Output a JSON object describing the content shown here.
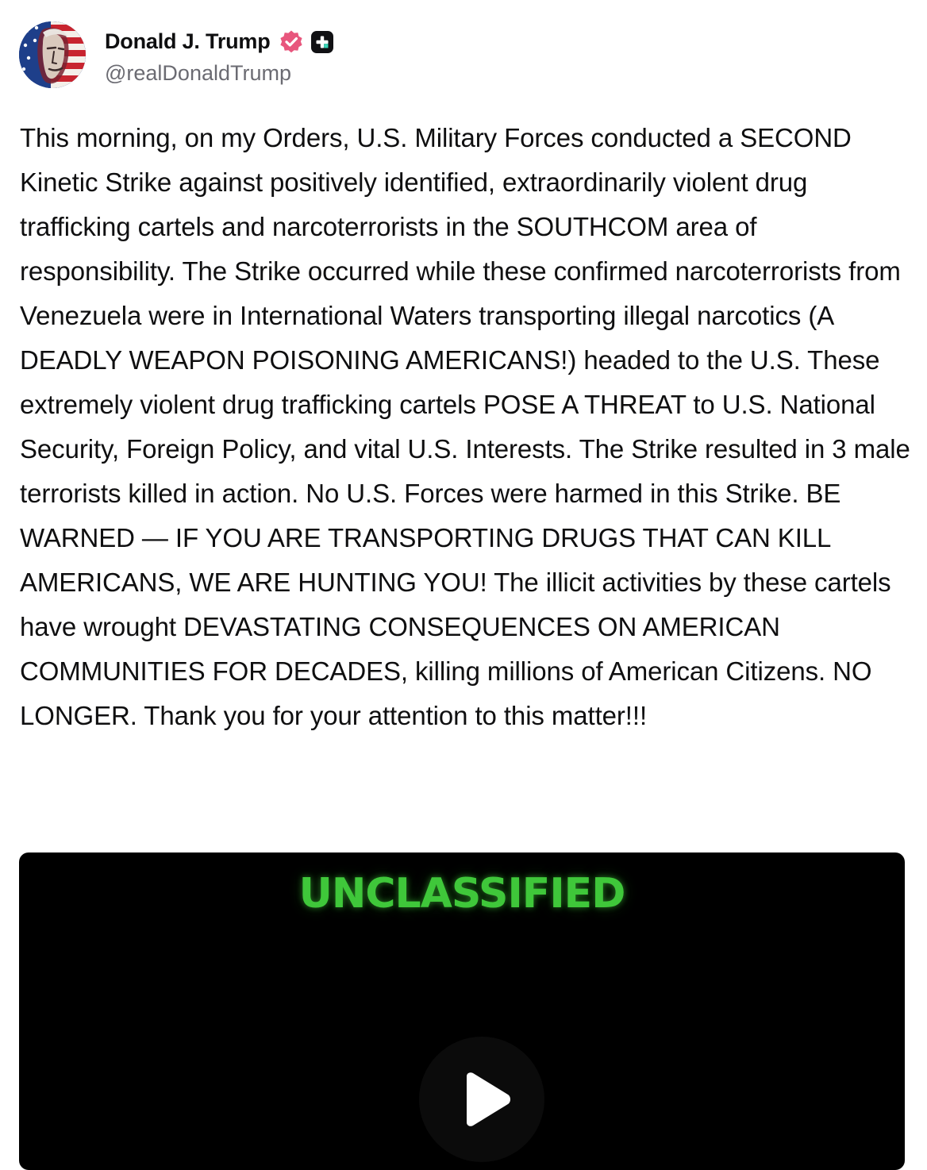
{
  "author": {
    "display_name": "Donald J. Trump",
    "handle": "@realDonaldTrump",
    "avatar_icon": "portrait-flag-avatar",
    "verified_icon": "verified-badge-icon",
    "verified_color": "#e8567d",
    "plus_icon": "plus-badge-icon"
  },
  "post": {
    "text": "This morning, on my Orders, U.S. Military Forces conducted a SECOND Kinetic Strike against positively identified, extraordinarily violent drug trafficking cartels and narcoterrorists in the SOUTHCOM area of responsibility. The Strike occurred while these confirmed narcoterrorists from Venezuela were in International Waters transporting illegal narcotics (A DEADLY WEAPON POISONING AMERICANS!) headed to the U.S. These extremely violent drug trafficking cartels POSE A THREAT to U.S. National Security, Foreign Policy, and vital U.S. Interests. The Strike resulted in 3 male terrorists killed in action. No U.S. Forces were harmed in this Strike. BE WARNED — IF YOU ARE TRANSPORTING DRUGS THAT CAN KILL AMERICANS, WE ARE HUNTING YOU! The illicit activities by these cartels have wrought DEVASTATING CONSEQUENCES ON AMERICAN COMMUNITIES FOR DECADES, killing millions of American Citizens. NO LONGER. Thank you for your attention to this matter!!!"
  },
  "video": {
    "overlay_text": "UNCLASSIFIED",
    "overlay_color": "#3fc73a",
    "play_icon": "play-icon"
  }
}
